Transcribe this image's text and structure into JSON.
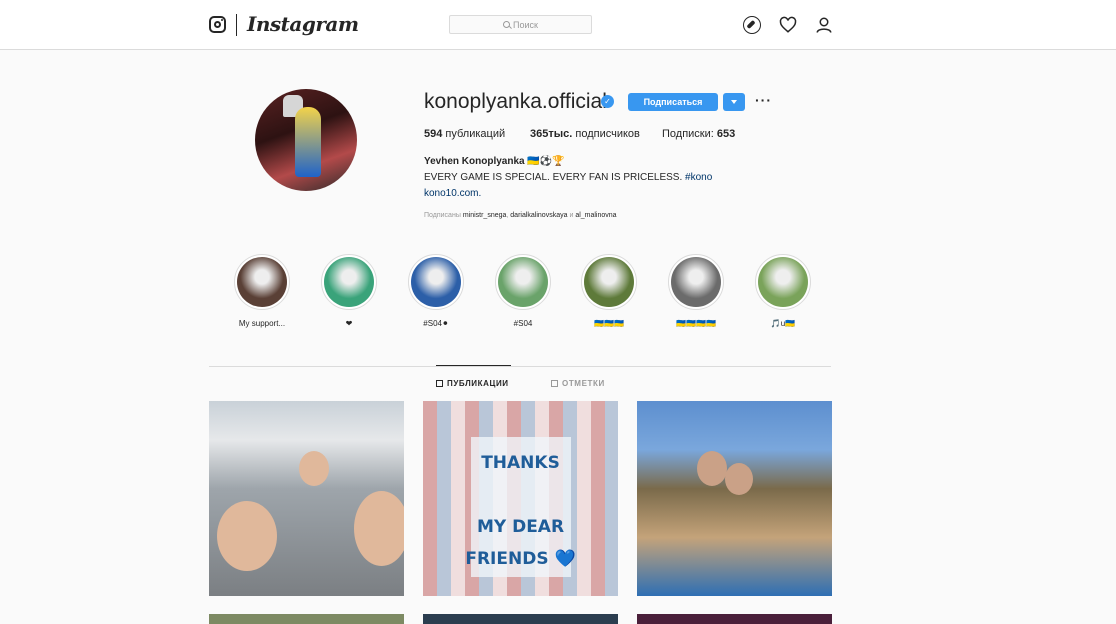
{
  "header": {
    "logo_text": "Instagram",
    "search_placeholder": "Поиск",
    "icons": [
      "instagram-camera-icon",
      "compass-icon",
      "heart-icon",
      "person-icon"
    ]
  },
  "profile": {
    "username": "konoplyanka.official",
    "verified": true,
    "follow_label": "Подписаться",
    "posts_count": "594",
    "posts_label": "публикаций",
    "followers_count": "365тыс.",
    "followers_label": "подписчиков",
    "following_label": "Подписки:",
    "following_count": "653",
    "full_name": "Yevhen Konoplyanka 🇺🇦⚽🏆",
    "bio_text": "EVERY GAME IS SPECIAL. EVERY FAN IS PRICELESS.",
    "bio_tag": "#kono",
    "website": "kono10.com.",
    "followed_by_prefix": "Подписаны",
    "followed_by_1": "ministr_snega",
    "followed_by_2": "darialkalinovskaya",
    "followed_by_and": "и",
    "followed_by_3": "al_malinovna"
  },
  "highlights": [
    {
      "label": "My support...",
      "color": "#5a4036"
    },
    {
      "label": "❤",
      "color": "#3aa37a"
    },
    {
      "label": "#S04⚫",
      "color": "#2c5fa8"
    },
    {
      "label": "#S04",
      "color": "#6aa36a"
    },
    {
      "label": "🇺🇦🇺🇦🇺🇦",
      "color": "#5e7a3a"
    },
    {
      "label": "🇺🇦🇺🇦🇺🇦🇺🇦",
      "color": "#6b6b6b"
    },
    {
      "label": "🎵u🇺🇦",
      "color": "#7aa35a"
    }
  ],
  "tabs": {
    "posts_label": "ПУБЛИКАЦИИ",
    "tagged_label": "ОТМЕТКИ"
  },
  "posts": {
    "p2_line1": "THANKS",
    "p2_line2": "MY DEAR",
    "p2_line3": "FRIENDS 💙"
  }
}
